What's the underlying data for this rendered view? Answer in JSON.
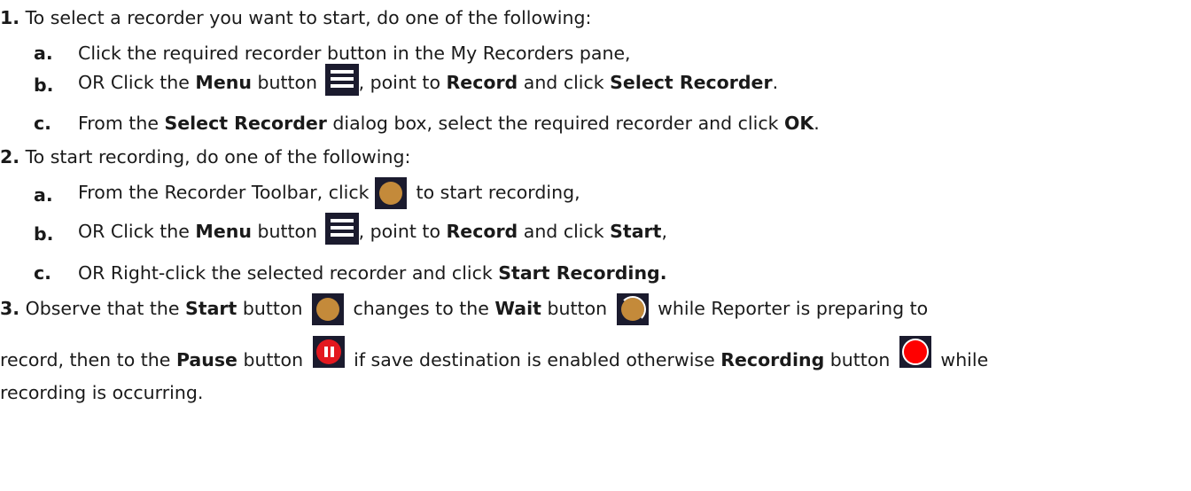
{
  "steps": [
    {
      "num": "1.",
      "text": "To select a recorder you want to start, do one of the following:",
      "subs": [
        {
          "letter": "a.",
          "parts": [
            "Click the required recorder button in the My Recorders pane,"
          ]
        },
        {
          "letter": "b.",
          "parts": [
            "OR Click the ",
            "Menu",
            " button ",
            ", point to ",
            "Record",
            " and click ",
            "Select Recorder",
            "."
          ]
        },
        {
          "letter": "c.",
          "parts": [
            "From the ",
            "Select Recorder",
            " dialog box, select the required recorder and click ",
            "OK",
            "."
          ]
        }
      ]
    },
    {
      "num": "2.",
      "text": "To start recording, do one of the following:",
      "subs": [
        {
          "letter": "a.",
          "parts": [
            "From the Recorder Toolbar, click ",
            " to start recording,"
          ]
        },
        {
          "letter": "b.",
          "parts": [
            "OR Click the ",
            "Menu",
            " button ",
            ", point to ",
            "Record",
            " and click ",
            "Start",
            ","
          ]
        },
        {
          "letter": "c.",
          "parts": [
            "OR Right-click the selected recorder and click ",
            "Start Recording."
          ]
        }
      ]
    },
    {
      "num": "3.",
      "parts_line1": [
        "Observe that the ",
        "Start",
        " button ",
        " changes to the ",
        "Wait",
        " button ",
        " while Reporter is preparing to"
      ],
      "parts_line2": [
        "record, then to the ",
        "Pause",
        " button ",
        " if save destination is enabled otherwise ",
        "Recording",
        " button ",
        " while"
      ],
      "parts_line3": [
        "recording is occurring."
      ]
    }
  ],
  "icons": {
    "menu": "menu-icon",
    "start": "start-record-icon",
    "wait": "wait-icon",
    "pause": "pause-icon",
    "recording": "recording-icon",
    "start_color": "#c48a3a",
    "pause_color": "#e3181f",
    "recording_color": "#ff0000",
    "icon_bg": "#1b1b2e"
  }
}
